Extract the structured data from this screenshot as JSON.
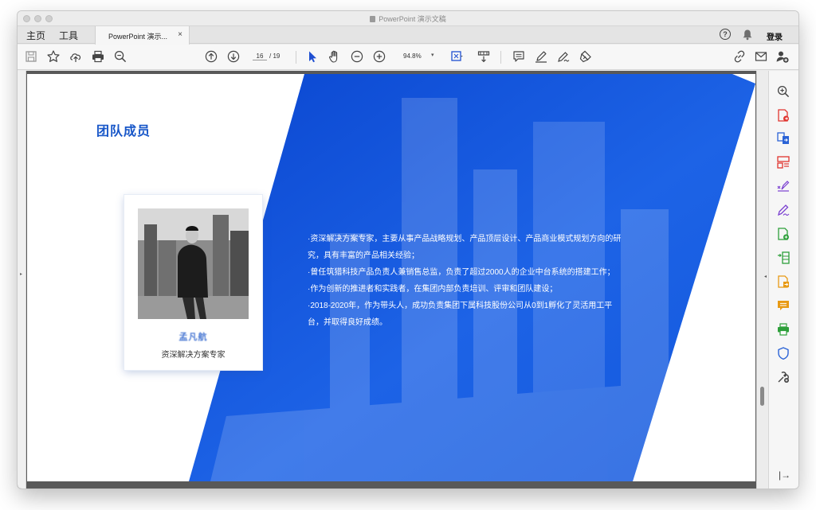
{
  "window": {
    "title": "PowerPoint 演示文稿"
  },
  "nav": {
    "home": "主页",
    "tools": "工具"
  },
  "tab": {
    "label": "PowerPoint 演示...",
    "close": "×"
  },
  "header_right": {
    "help": "?",
    "login": "登录"
  },
  "toolbar": {
    "page_current": "16",
    "page_total": "/ 19",
    "zoom": "94.8%",
    "zoom_caret": "▾",
    "icons": [
      "save-icon",
      "bookmark-star-icon",
      "cloud-upload-icon",
      "print-icon",
      "zoom-search-icon",
      "page-up-icon",
      "page-down-icon",
      "select-arrow-icon",
      "hand-pan-icon",
      "zoom-out-icon",
      "zoom-in-icon",
      "fit-page-icon",
      "scroll-mode-icon",
      "comment-icon",
      "highlight-pen-icon",
      "fill-sign-icon",
      "draw-tools-icon",
      "share-link-icon",
      "email-icon",
      "add-user-icon"
    ]
  },
  "slide": {
    "title": "团队成员",
    "person": {
      "name": "孟凡航",
      "title": "资深解决方案专家"
    },
    "bio": [
      "·资深解决方案专家，主要从事产品战略规划、产品顶层设计、产品商业模式规划方向的研究，具有丰富的产品相关经验；",
      "·曾任筑猎科技产品负责人兼销售总监，负责了超过2000人的企业中台系统的搭建工作；",
      "·作为创新的推进者和实践者，在集团内部负责培训、评审和团队建设；",
      "·2018-2020年，作为带头人，成功负责集团下属科技股份公司从0到1孵化了灵活用工平台，并取得良好成绩。"
    ]
  },
  "right_rail": {
    "icons": [
      "zoom-search-icon",
      "export-pdf-icon",
      "combine-files-icon",
      "organize-pages-icon",
      "redact-icon",
      "fill-sign-icon",
      "edit-pdf-icon",
      "excel-export-icon",
      "create-pdf-icon",
      "comment-icon",
      "print-production-icon",
      "protect-shield-icon",
      "more-tools-icon"
    ],
    "expand": "|→",
    "colors": {
      "red": "#e0342f",
      "blue": "#2b63d6",
      "purple": "#7a3fd0",
      "green": "#2d9f3a",
      "orange": "#e89a14"
    }
  },
  "colors": {
    "accent_blue": "#1756c8",
    "slide_band": "#1a5fe0"
  },
  "left_collapse": "▸",
  "rail_collapse": "◂"
}
